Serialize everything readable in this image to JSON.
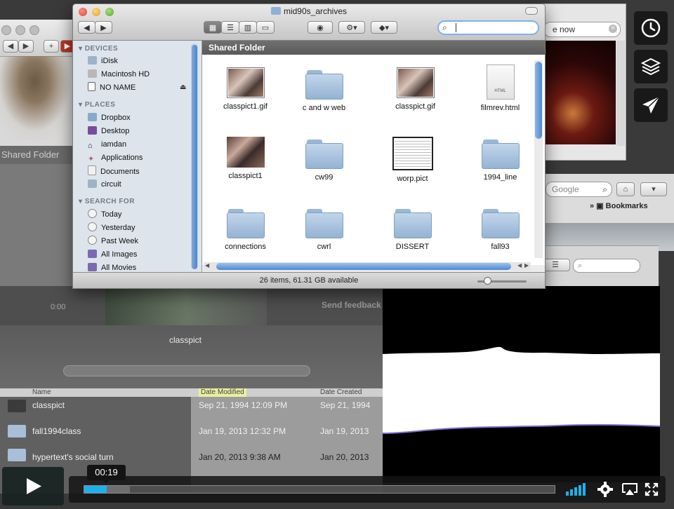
{
  "finder": {
    "title": "mid90s_archives",
    "section_header": "Shared Folder",
    "status": "26 items, 61.31 GB available",
    "search_value": "",
    "sidebar": [
      {
        "heading": "DEVICES",
        "items": [
          {
            "label": "iDisk",
            "icon": "idisk-icon"
          },
          {
            "label": "Macintosh HD",
            "icon": "hard-drive-icon"
          },
          {
            "label": "NO NAME",
            "icon": "removable-drive-icon"
          }
        ]
      },
      {
        "heading": "PLACES",
        "items": [
          {
            "label": "Dropbox",
            "icon": "dropbox-folder-icon"
          },
          {
            "label": "Desktop",
            "icon": "desktop-icon"
          },
          {
            "label": "iamdan",
            "icon": "home-icon"
          },
          {
            "label": "Applications",
            "icon": "applications-icon"
          },
          {
            "label": "Documents",
            "icon": "documents-icon"
          },
          {
            "label": "circuit",
            "icon": "folder-icon"
          }
        ]
      },
      {
        "heading": "SEARCH FOR",
        "items": [
          {
            "label": "Today",
            "icon": "clock-icon"
          },
          {
            "label": "Yesterday",
            "icon": "clock-icon"
          },
          {
            "label": "Past Week",
            "icon": "clock-icon"
          },
          {
            "label": "All Images",
            "icon": "smart-folder-icon"
          },
          {
            "label": "All Movies",
            "icon": "smart-folder-icon"
          }
        ]
      }
    ],
    "files": [
      {
        "name": "classpict1.gif",
        "kind": "image"
      },
      {
        "name": "c and w web",
        "kind": "folder"
      },
      {
        "name": "classpict.gif",
        "kind": "image"
      },
      {
        "name": "filmrev.html",
        "kind": "html"
      },
      {
        "name": "classpict1",
        "kind": "image"
      },
      {
        "name": "cw99",
        "kind": "folder"
      },
      {
        "name": "worp.pict",
        "kind": "pict"
      },
      {
        "name": "1994_line",
        "kind": "folder"
      },
      {
        "name": "connections",
        "kind": "folder"
      },
      {
        "name": "cwrl",
        "kind": "folder"
      },
      {
        "name": "DISSERT",
        "kind": "folder"
      },
      {
        "name": "fall93",
        "kind": "folder"
      }
    ],
    "html_badge": "HTML"
  },
  "background": {
    "left_shared_folder": "Shared Folder",
    "right_search_text": "e now",
    "google_placeholder": "Google",
    "bookmarks_label": "Bookmarks",
    "send_feedback": "Send feedback",
    "video_time": "0:00",
    "classpict_label": "classpict",
    "list_headers": {
      "name": "Name",
      "modified": "Date Modified",
      "created": "Date Created"
    },
    "list_rows": [
      {
        "name": "classpict",
        "modified": "Sep 21, 1994 12:09 PM",
        "created": "Sep 21, 1994"
      },
      {
        "name": "fall1994class",
        "modified": "Jan 19, 2013 12:32 PM",
        "created": "Jan 19, 2013"
      },
      {
        "name": "hypertext's social turn",
        "modified": "Jan 20, 2013 9:38 AM",
        "created": "Jan 20, 2013"
      }
    ]
  },
  "player": {
    "current_time": "00:19",
    "progress_fraction": 0.048,
    "loaded_fraction": 0.097
  },
  "colors": {
    "accent": "#1fb0ea",
    "finder_selection": "#4a86cd"
  }
}
